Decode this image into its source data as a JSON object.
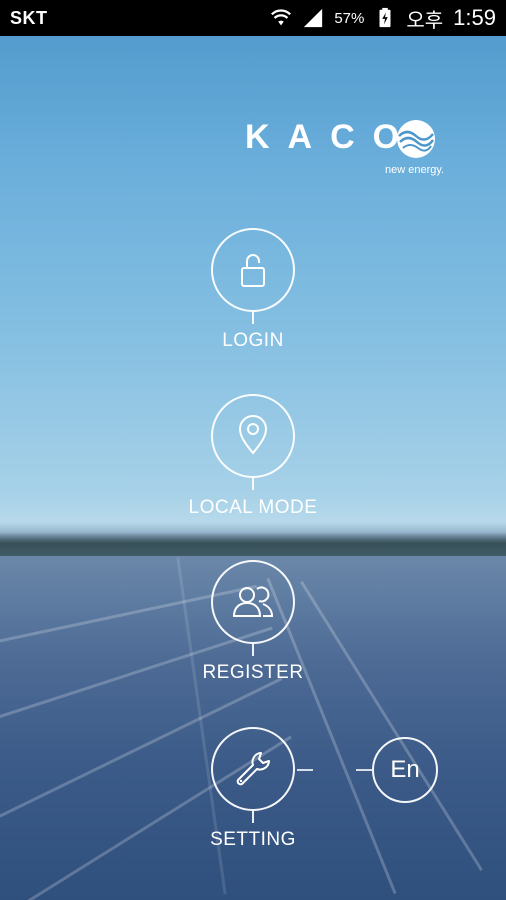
{
  "status_bar": {
    "carrier": "SKT",
    "battery_percent": "57%",
    "ampm": "오후",
    "time": "1:59",
    "wifi_icon": "wifi-icon",
    "signal_icon": "signal-icon",
    "battery_icon": "battery-charging-icon"
  },
  "brand": {
    "logo_text": "KACO",
    "tagline": "new energy."
  },
  "menu": {
    "login": {
      "label": "LOGIN",
      "icon": "unlock-icon"
    },
    "local_mode": {
      "label": "LOCAL MODE",
      "icon": "location-pin-icon"
    },
    "register": {
      "label": "REGISTER",
      "icon": "users-icon"
    },
    "setting": {
      "label": "SETTING",
      "icon": "wrench-icon"
    },
    "language": {
      "label": "En"
    }
  },
  "colors": {
    "status_bar_bg": "#000000",
    "sky_top": "#4c97c9",
    "panel_blue": "#3c5b88",
    "foreground": "#ffffff"
  }
}
